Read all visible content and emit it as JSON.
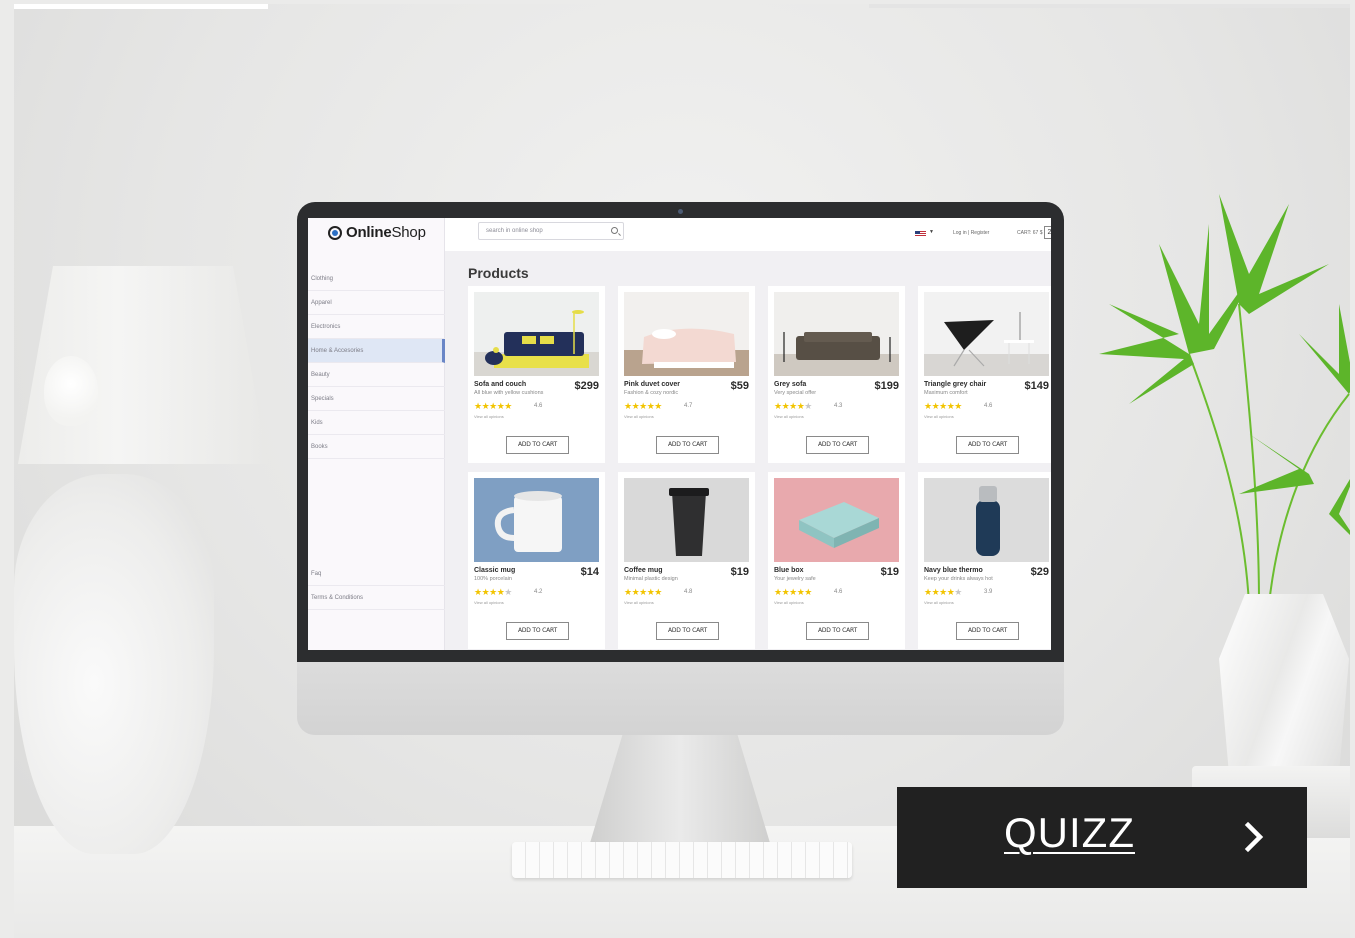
{
  "shop": {
    "logo_bold": "Online",
    "logo_light": "Shop",
    "search_placeholder": "search in online shop",
    "login": "Log in  |  Register",
    "cart_label": "CART: 67 $",
    "cart_count": "2",
    "products_title": "Products",
    "categories": [
      "Clothing",
      "Apparel",
      "Electronics",
      "Home & Accesories",
      "Beauty",
      "Specials",
      "Kids",
      "Books"
    ],
    "active_category": "Home & Accesories",
    "footer_links": [
      "Faq",
      "Terms & Conditions"
    ],
    "view_opinions": "View all opinions",
    "add_to_cart": "ADD TO CART",
    "products": [
      {
        "name": "Sofa and couch",
        "sub": "All blue with yellow cushions",
        "price": "$299",
        "rating": "4.6",
        "stars": 5
      },
      {
        "name": "Pink duvet cover",
        "sub": "Fashion & cozy nordic",
        "price": "$59",
        "rating": "4.7",
        "stars": 5
      },
      {
        "name": "Grey sofa",
        "sub": "Very special offer",
        "price": "$199",
        "rating": "4.3",
        "stars": 4
      },
      {
        "name": "Triangle grey chair",
        "sub": "Maximum comfort",
        "price": "$149",
        "rating": "4.6",
        "stars": 5
      },
      {
        "name": "Classic mug",
        "sub": "100% porcelain",
        "price": "$14",
        "rating": "4.2",
        "stars": 4
      },
      {
        "name": "Coffee mug",
        "sub": "Minimal plastic design",
        "price": "$19",
        "rating": "4.8",
        "stars": 5
      },
      {
        "name": "Blue box",
        "sub": "Your jewelry safe",
        "price": "$19",
        "rating": "4.6",
        "stars": 5
      },
      {
        "name": "Navy blue thermo",
        "sub": "Keep your drinks always hot",
        "price": "$29",
        "rating": "3.9",
        "stars": 4
      }
    ]
  },
  "quizz": {
    "label": "QUIZZ",
    "arrow_icon": "chevron-right-icon"
  },
  "colors": {
    "accent": "#6a86c6",
    "star": "#f2c400",
    "quizz_bg": "#212121"
  }
}
